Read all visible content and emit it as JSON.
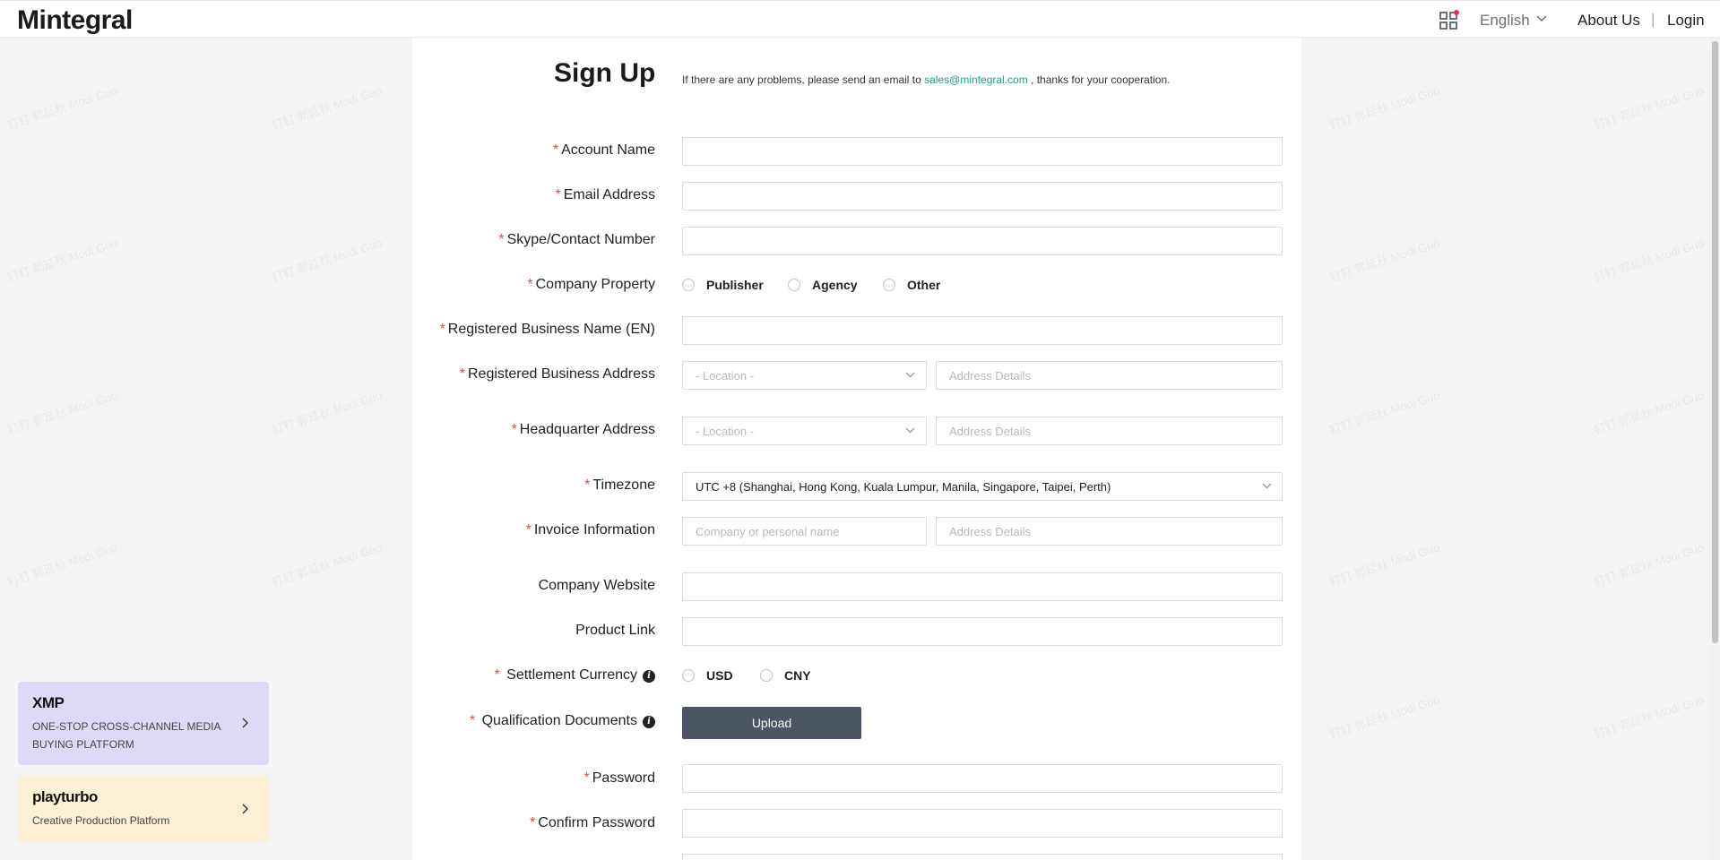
{
  "header": {
    "logo": "Mintegral",
    "language": "English",
    "about": "About Us",
    "separator": "|",
    "login": "Login"
  },
  "page": {
    "title": "Sign Up",
    "notice_before": "If there are any problems, please send an email to ",
    "notice_email": "sales@mintegral.com",
    "notice_after": " , thanks for your cooperation."
  },
  "form": {
    "required_mark": "*",
    "account_name": "Account Name",
    "email_address": "Email Address",
    "skype": "Skype/Contact Number",
    "company_property": "Company Property",
    "property_options": [
      "Publisher",
      "Agency",
      "Other"
    ],
    "business_name": "Registered Business Name (EN)",
    "business_address": "Registered Business Address",
    "headquarter_address": "Headquarter Address",
    "location_placeholder": "- Location -",
    "address_placeholder": "Address Details",
    "timezone": "Timezone",
    "timezone_value": "UTC +8 (Shanghai, Hong Kong, Kuala Lumpur, Manila, Singapore, Taipei, Perth)",
    "invoice": "Invoice Information",
    "invoice_name_placeholder": "Company or personal name",
    "company_website": "Company Website",
    "product_link": "Product Link",
    "settlement_currency": "Settlement Currency",
    "currency_options": [
      "USD",
      "CNY"
    ],
    "qualification_documents": "Qualification Documents",
    "upload": "Upload",
    "password": "Password",
    "confirm_password": "Confirm Password"
  },
  "promos": {
    "xmp_logo": "XMP",
    "xmp_text": "ONE-STOP CROSS-CHANNEL MEDIA BUYING PLATFORM",
    "playturbo_logo": "playturbo",
    "playturbo_text": "Creative Production Platform"
  },
  "watermark": "钉钉 郭延秋 Modi Guo",
  "colors": {
    "accent": "#16a085",
    "required": "#e74c3c",
    "button": "#4b5566"
  }
}
